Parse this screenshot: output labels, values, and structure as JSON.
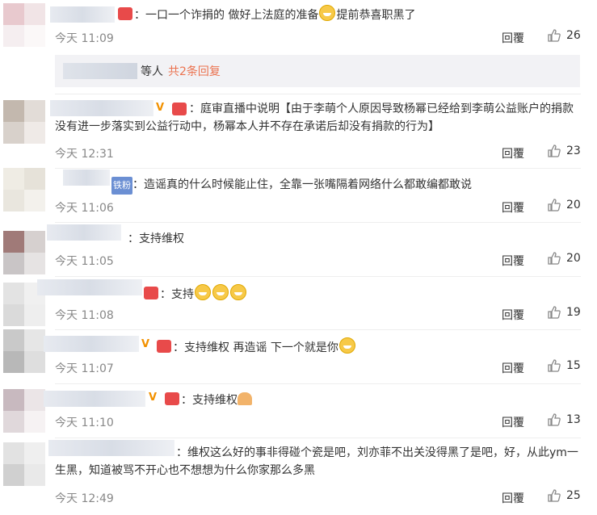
{
  "comments": [
    {
      "text": "：一口一个诈捐的 做好上法庭的准备",
      "text_suffix": "提前恭喜职黑了",
      "time": "今天 11:09",
      "reply": "回覆",
      "likes": "26"
    },
    {
      "text": "：庭审直播中说明【由于李萌个人原因导致杨幂已经给到李萌公益账户的捐款没有进一步落实到公益行动中，杨幂本人并不存在承诺后却没有捐款的行为】",
      "time": "今天 12:31",
      "reply": "回覆",
      "likes": "23"
    },
    {
      "badge": "铁粉",
      "text": "：造谣真的什么时候能止住，全靠一张嘴隔着网络什么都敢编都敢说",
      "time": "今天 11:06",
      "reply": "回覆",
      "likes": "20"
    },
    {
      "text": "：支持维权",
      "time": "今天 11:05",
      "reply": "回覆",
      "likes": "20"
    },
    {
      "text": "：支持",
      "time": "今天 11:08",
      "reply": "回覆",
      "likes": "19"
    },
    {
      "text": "：支持维权 再造谣 下一个就是你",
      "time": "今天 11:07",
      "reply": "回覆",
      "likes": "15"
    },
    {
      "text": "：支持维权",
      "time": "今天 11:10",
      "reply": "回覆",
      "likes": "13"
    },
    {
      "text": "：维权这么好的事非得碰个瓷是吧，刘亦菲不出关没得黑了是吧，好，从此ym一生黑，知道被骂不开心也不想想为什么你家那么多黑",
      "time": "今天 12:49",
      "reply": "回覆",
      "likes": "25"
    }
  ],
  "reply_summary": {
    "who": "等人",
    "more": "共2条回复"
  },
  "colors": {
    "link": "#eb7350",
    "vip": "#f29100"
  }
}
